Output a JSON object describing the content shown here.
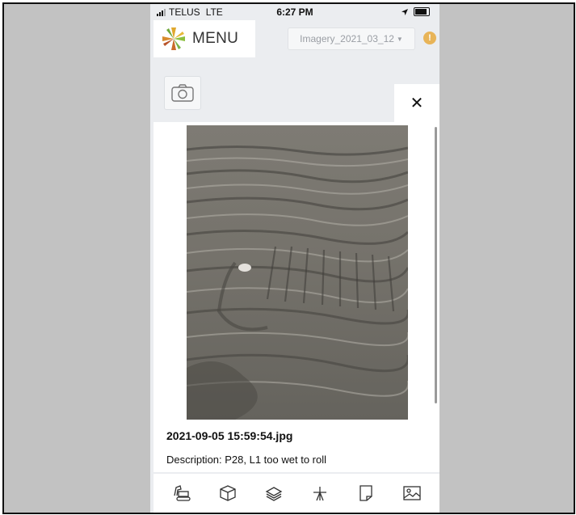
{
  "status_bar": {
    "carrier": "TELUS",
    "network": "LTE",
    "time": "6:27 PM"
  },
  "header": {
    "menu_label": "MENU",
    "imagery_select": "Imagery_2021_03_12",
    "alert_badge": "!"
  },
  "panel": {
    "close_glyph": "✕",
    "photo_icon": "field-photo",
    "file_name": "2021-09-05 15:59:54.jpg",
    "description": "Description: P28, L1 too wet to roll"
  },
  "toolbar": {
    "items": [
      "excavator-icon",
      "box-icon",
      "layers-icon",
      "survey-icon",
      "note-icon",
      "image-icon"
    ]
  },
  "colors": {
    "background": "#c2c2c2",
    "app_background": "#ebedf0",
    "alert": "#e8b458"
  }
}
